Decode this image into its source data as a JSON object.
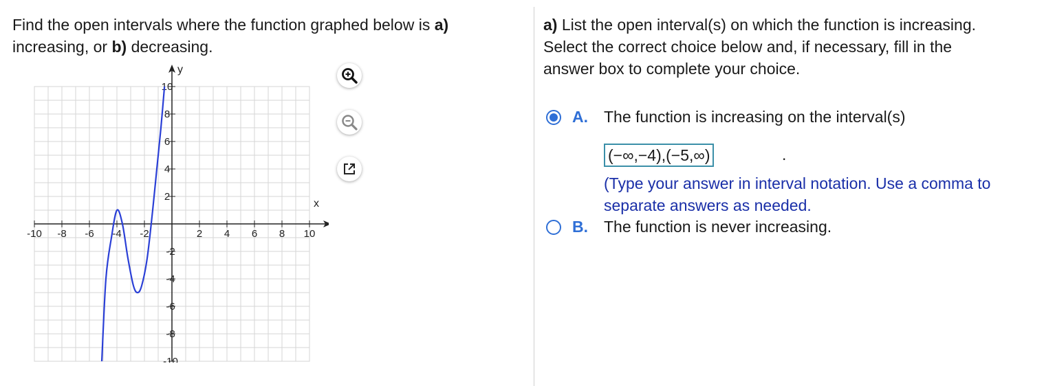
{
  "question": {
    "prefix": "Find the open intervals where the function graphed below is ",
    "bold_a": "a)",
    "line2_prefix": "increasing, or ",
    "bold_b": "b)",
    "line2_suffix": " decreasing."
  },
  "graph": {
    "x_axis_label": "x",
    "y_axis_label": "y",
    "x_ticks": [
      "-10",
      "-8",
      "-6",
      "-4",
      "-2",
      "2",
      "4",
      "6",
      "8",
      "10"
    ],
    "y_ticks": [
      "10",
      "8",
      "6",
      "4",
      "2",
      "2",
      "4",
      "6",
      "8",
      "10"
    ],
    "x_range": [
      -10,
      10
    ],
    "y_range": [
      -10,
      10
    ],
    "curve_color": "#2a3fd6",
    "curve_points": [
      [
        -5.1,
        -10
      ],
      [
        -4.8,
        -4
      ],
      [
        -4.4,
        -1
      ],
      [
        -4,
        1
      ],
      [
        -3.6,
        0
      ],
      [
        -3.2,
        -2.5
      ],
      [
        -2.8,
        -4.5
      ],
      [
        -2.5,
        -5
      ],
      [
        -2.2,
        -4.5
      ],
      [
        -1.8,
        -2.5
      ],
      [
        -1.4,
        1
      ],
      [
        -1.1,
        4
      ],
      [
        -0.8,
        7
      ],
      [
        -0.5,
        10.5
      ]
    ]
  },
  "tools": {
    "zoom_in_icon": "magnifier-plus-icon",
    "zoom_out_icon": "magnifier-minus-icon",
    "popout_icon": "external-link-icon"
  },
  "part_a": {
    "prompt_bold": "a)",
    "prompt_line1": " List the open interval(s) on which the function is increasing.",
    "prompt_line2": "Select the correct choice below and, if necessary, fill in the",
    "prompt_line3": "answer box to complete your choice.",
    "choice_a_letter": "A.",
    "choice_a_text": "The function is increasing on the interval(s)",
    "answer_value": "(−∞,−4),(−5,∞)",
    "answer_period": ".",
    "hint_line1": "(Type your answer in interval notation. Use a comma to",
    "hint_line2": "separate answers as needed.",
    "choice_b_letter": "B.",
    "choice_b_text": "The function is never increasing.",
    "selected": "A",
    "accent_color": "#2f6fd6"
  }
}
